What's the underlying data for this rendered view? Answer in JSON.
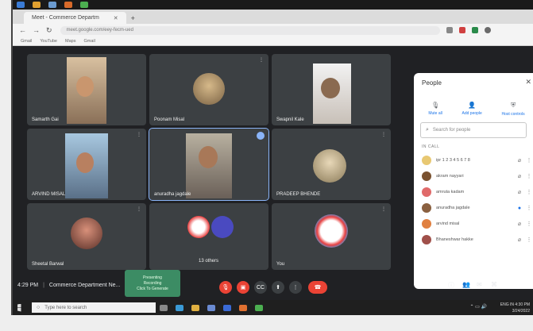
{
  "browser": {
    "tab_title": "Meet - Commerce Departm",
    "url": "meet.google.com/eey-fecm-ued",
    "bookmarks": [
      "Gmail",
      "YouTube",
      "Maps",
      "Gmail"
    ]
  },
  "participants": [
    {
      "name": "Samarth Gai"
    },
    {
      "name": "Poonam Misal"
    },
    {
      "name": "Swapnil Kale"
    },
    {
      "name": "ARVIND MISAL"
    },
    {
      "name": "anuradha jagdale"
    },
    {
      "name": "PRADEEP BHENDE"
    },
    {
      "name": "Sheetal Barwal"
    },
    {
      "name": "13 others"
    },
    {
      "name": "You"
    }
  ],
  "people_panel": {
    "title": "People",
    "actions": [
      "Mute all",
      "Add people",
      "Host controls"
    ],
    "search_placeholder": "Search for people",
    "section": "IN CALL",
    "list": [
      {
        "name": "ipr 1 2 3 4 5 6 7 8",
        "color": "#e8c872"
      },
      {
        "name": "akram nayyari",
        "color": "#7a5230"
      },
      {
        "name": "amruta kadam",
        "color": "#e06a6a"
      },
      {
        "name": "anuradha jagdale",
        "color": "#8a6040"
      },
      {
        "name": "arvind misal",
        "color": "#e08040"
      },
      {
        "name": "Bhaneshwar hakke",
        "color": "#a0504a"
      }
    ]
  },
  "bottom": {
    "time": "4:29 PM",
    "meeting_name": "Commerce Department Ne...",
    "toast_lines": [
      "Presenting",
      "Recording",
      "Click To Generate"
    ]
  },
  "taskbar": {
    "search_placeholder": "Type here to search",
    "clock_time": "4:30 PM",
    "clock_date": "3/24/2022",
    "lang": "ENG IN"
  },
  "colors": {
    "meet_bg": "#202124",
    "tile_bg": "#3c4043",
    "end_call": "#ea4335",
    "accent": "#8ab4f8"
  }
}
